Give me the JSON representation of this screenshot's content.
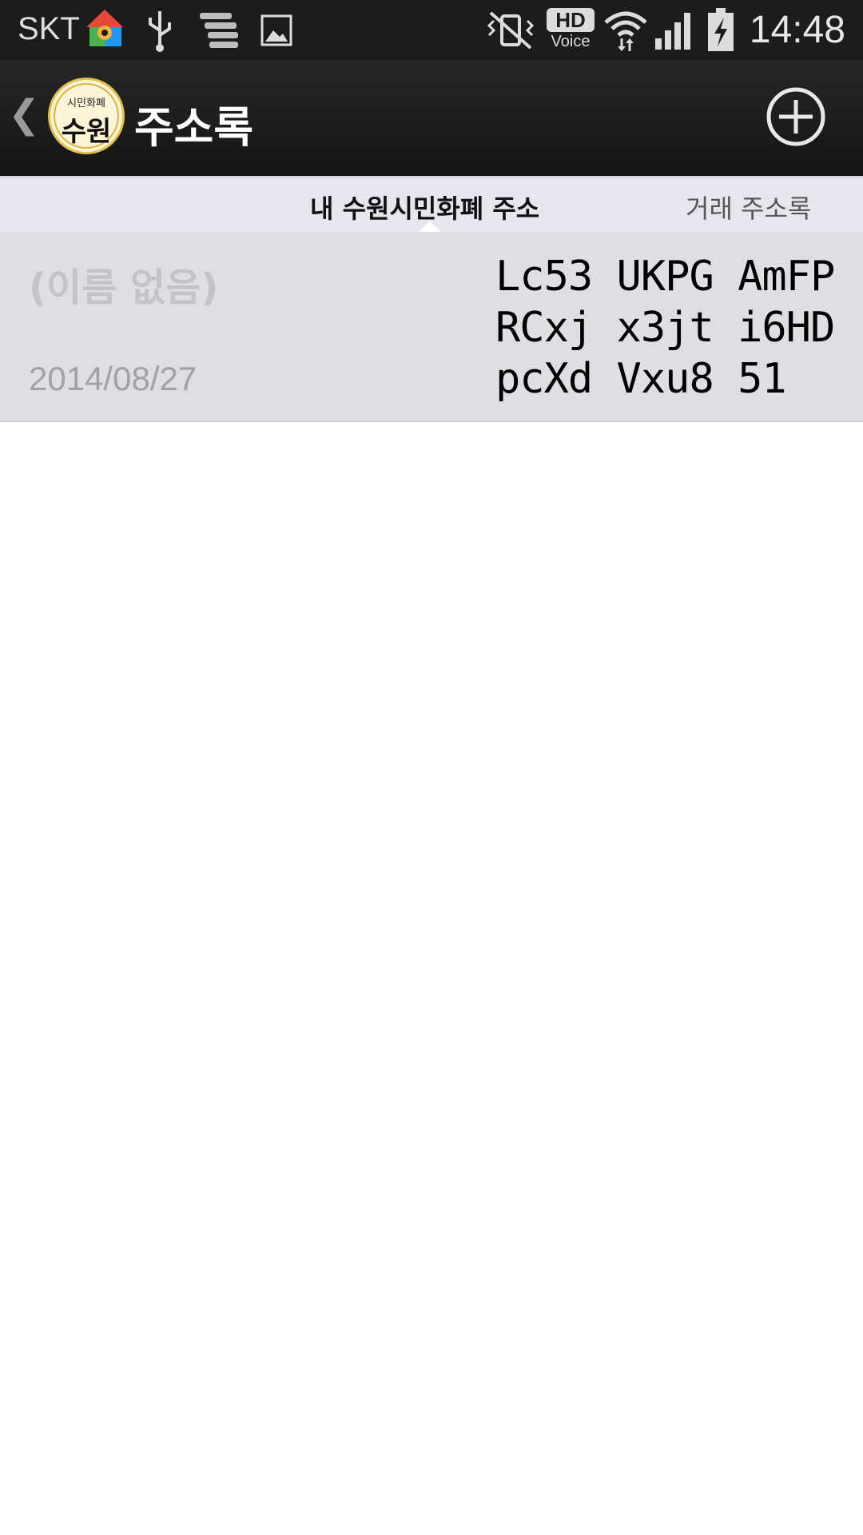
{
  "status_bar": {
    "carrier": "SKT",
    "time": "14:48",
    "icons": [
      "home-settings-icon",
      "usb-icon",
      "stack-icon",
      "image-icon",
      "vibrate-mute-icon",
      "hd-voice-icon",
      "wifi-icon",
      "signal-icon",
      "battery-charging-icon"
    ],
    "hd_label": "HD",
    "voice_label": "Voice"
  },
  "action_bar": {
    "back_icon": "chevron-left-icon",
    "logo_small": "시민화폐",
    "logo_big": "수원",
    "title": "주소록",
    "add_icon": "plus-circle-icon"
  },
  "tabs": [
    {
      "label": "내 수원시민화폐 주소",
      "active": true
    },
    {
      "label": "거래 주소록",
      "active": false
    }
  ],
  "addresses": [
    {
      "name": "(이름 없음)",
      "date": "2014/08/27",
      "address_lines": [
        "Lc53 UKPG AmFP",
        "RCxj x3jt i6HD",
        "pcXd Vxu8 51"
      ]
    }
  ],
  "colors": {
    "status_bar_bg": "#1c1c1c",
    "action_bar_bg": "#1a1a1a",
    "tab_bar_bg": "#e6e7ee",
    "list_item_bg": "#dfdfe3",
    "logo_bg": "#fbf4d6"
  }
}
